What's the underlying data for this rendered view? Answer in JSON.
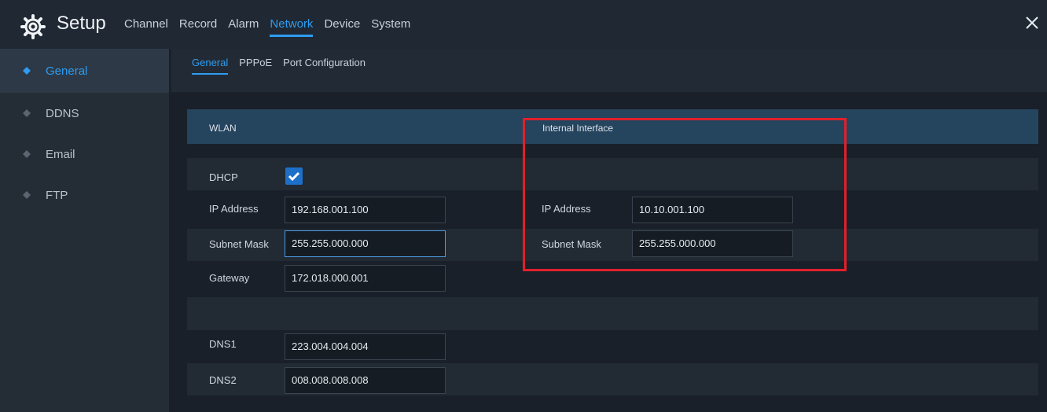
{
  "header": {
    "title": "Setup",
    "nav": [
      "Channel",
      "Record",
      "Alarm",
      "Network",
      "Device",
      "System"
    ],
    "active_nav": "Network"
  },
  "sidebar": {
    "items": [
      {
        "label": "General",
        "active": true
      },
      {
        "label": "DDNS"
      },
      {
        "label": "Email"
      },
      {
        "label": "FTP"
      }
    ]
  },
  "subtabs": [
    "General",
    "PPPoE",
    "Port Configuration"
  ],
  "sections": {
    "left": "WLAN",
    "right": "Internal Interface"
  },
  "fields": {
    "dhcp_label": "DHCP",
    "ip_label": "IP Address",
    "ip": "192.168.001.100",
    "subnet_label": "Subnet Mask",
    "subnet": "255.255.000.000",
    "gateway_label": "Gateway",
    "gateway": "172.018.000.001",
    "dns1_label": "DNS1",
    "dns1": "223.004.004.004",
    "dns2_label": "DNS2",
    "dns2": "008.008.008.008",
    "internal_ip_label": "IP Address",
    "internal_ip": "10.10.001.100",
    "internal_subnet_label": "Subnet Mask",
    "internal_subnet": "255.255.000.000"
  },
  "colors": {
    "accent": "#2e9cf0",
    "highlight": "#e0202b"
  }
}
